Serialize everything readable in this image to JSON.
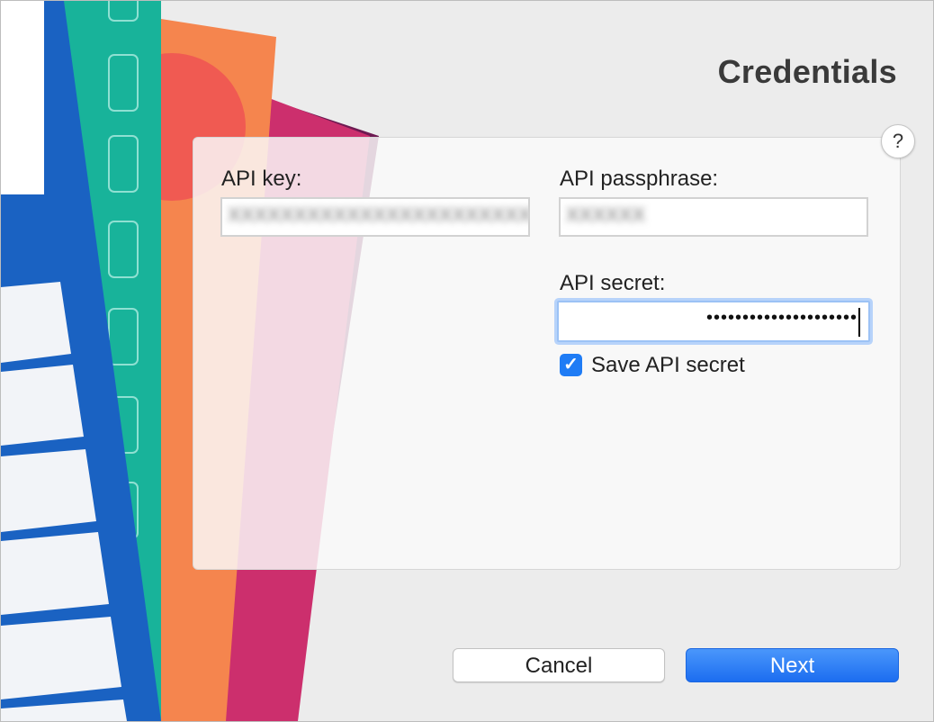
{
  "window": {
    "title": "Credentials",
    "help_label": "?"
  },
  "form": {
    "api_key": {
      "label": "API key:",
      "value": "XXXXXXXXXXXXXXXXXXXXXXXXXX"
    },
    "api_passphrase": {
      "label": "API passphrase:",
      "value": "XXXXXX"
    },
    "api_secret": {
      "label": "API secret:",
      "value": "•••••••••••••••••••••"
    },
    "save_secret": {
      "label": "Save API secret",
      "checked": true,
      "check_glyph": "✓"
    }
  },
  "buttons": {
    "cancel": "Cancel",
    "next": "Next"
  },
  "colors": {
    "accent": "#1f7cf5",
    "title_text": "#3a3a3a"
  },
  "icons": {
    "help": "question-icon",
    "check": "checkmark-icon"
  }
}
